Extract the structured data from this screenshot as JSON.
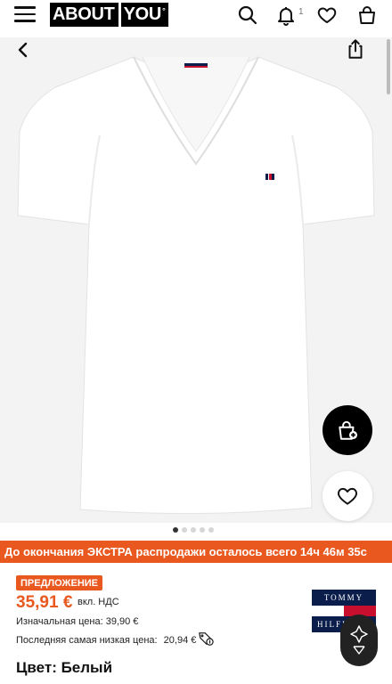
{
  "header": {
    "logo_part1": "ABOUT",
    "logo_part2": "YOU",
    "logo_mark": "°",
    "notification_count": "1",
    "icons": [
      "menu-icon",
      "search-icon",
      "bell-icon",
      "heart-icon",
      "bag-icon"
    ]
  },
  "gallery": {
    "icons": [
      "chevron-left-icon",
      "share-icon",
      "bag-add-icon",
      "heart-icon"
    ],
    "image_count": 5,
    "active_index": 0
  },
  "promo": {
    "text": "До окончания ЭКСТРА распродажи осталось всего 14ч 46м 35с"
  },
  "pricing": {
    "badge": "ПРЕДЛОЖЕНИЕ",
    "price": "35,91 €",
    "vat": "вкл. НДС",
    "original": "Изначальная цена: 39,90 €",
    "lowest_label": "Последняя самая низкая цена:",
    "lowest_value": "20,94 €"
  },
  "brand": {
    "top_text": "TOMMY",
    "bottom_text": "HILFIGER"
  },
  "product": {
    "color_label": "Цвет: Белый"
  },
  "colors": {
    "accent": "#e9581e",
    "brand_navy": "#0b1e4b",
    "brand_red": "#c8102e"
  }
}
